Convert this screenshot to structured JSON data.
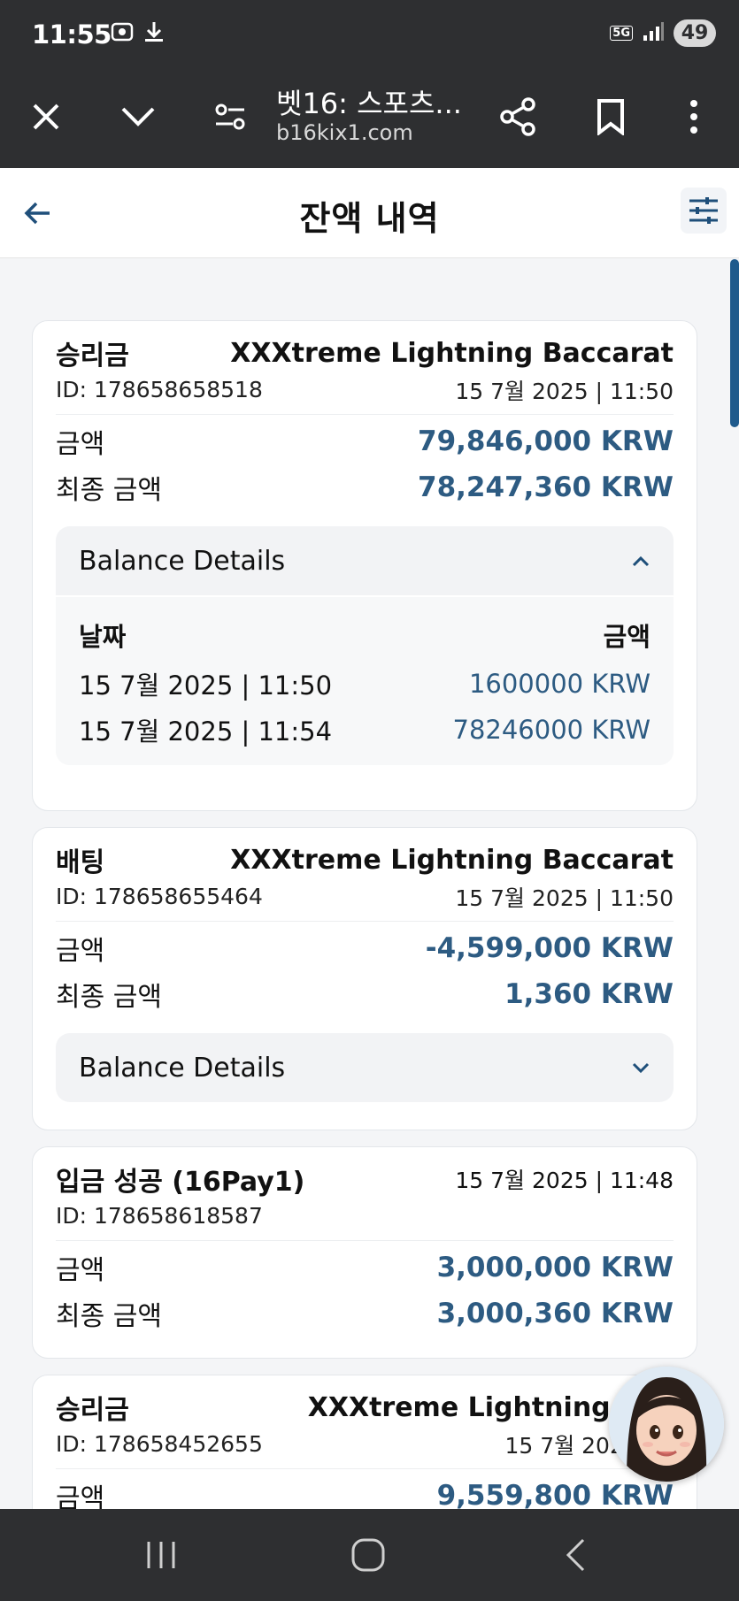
{
  "status_bar": {
    "time": "11:55",
    "network": "5G",
    "battery": "49"
  },
  "browser": {
    "tab_title": "벳16: 스포츠...",
    "host": "b16kix1.com"
  },
  "header": {
    "title": "잔액 내역"
  },
  "transactions": [
    {
      "type": "승리금",
      "game": "XXXtreme Lightning Baccarat",
      "id": "ID: 178658658518",
      "date": "15 7월 2025 | 11:50",
      "amount_label": "금액",
      "amount": "79,846,000 KRW",
      "final_label": "최종 금액",
      "final_amount": "78,247,360 KRW",
      "details_label": "Balance Details",
      "details_expanded": true,
      "details_header_date": "날짜",
      "details_header_amount": "금액",
      "details_rows": [
        {
          "date": "15 7월 2025 | 11:50",
          "amount": "1600000 KRW"
        },
        {
          "date": "15 7월 2025 | 11:54",
          "amount": "78246000 KRW"
        }
      ]
    },
    {
      "type": "배팅",
      "game": "XXXtreme Lightning Baccarat",
      "id": "ID: 178658655464",
      "date": "15 7월 2025 | 11:50",
      "amount_label": "금액",
      "amount": "-4,599,000 KRW",
      "final_label": "최종 금액",
      "final_amount": "1,360 KRW",
      "details_label": "Balance Details",
      "details_expanded": false
    },
    {
      "type": "입금 성공 (16Pay1)",
      "date": "15 7월 2025 | 11:48",
      "id": "ID: 178658618587",
      "amount_label": "금액",
      "amount": "3,000,000 KRW",
      "final_label": "최종 금액",
      "final_amount": "3,000,360 KRW"
    },
    {
      "type": "승리금",
      "game": "XXXtreme Lightning Bac",
      "id": "ID: 178658452655",
      "date": "15 7월 2025 | 1",
      "amount_label": "금액",
      "amount": "9,559,800 KRW"
    }
  ],
  "colors": {
    "chrome": "#2e2f31",
    "amount": "#2d5b82",
    "scrollbar": "#1f5a8c"
  }
}
